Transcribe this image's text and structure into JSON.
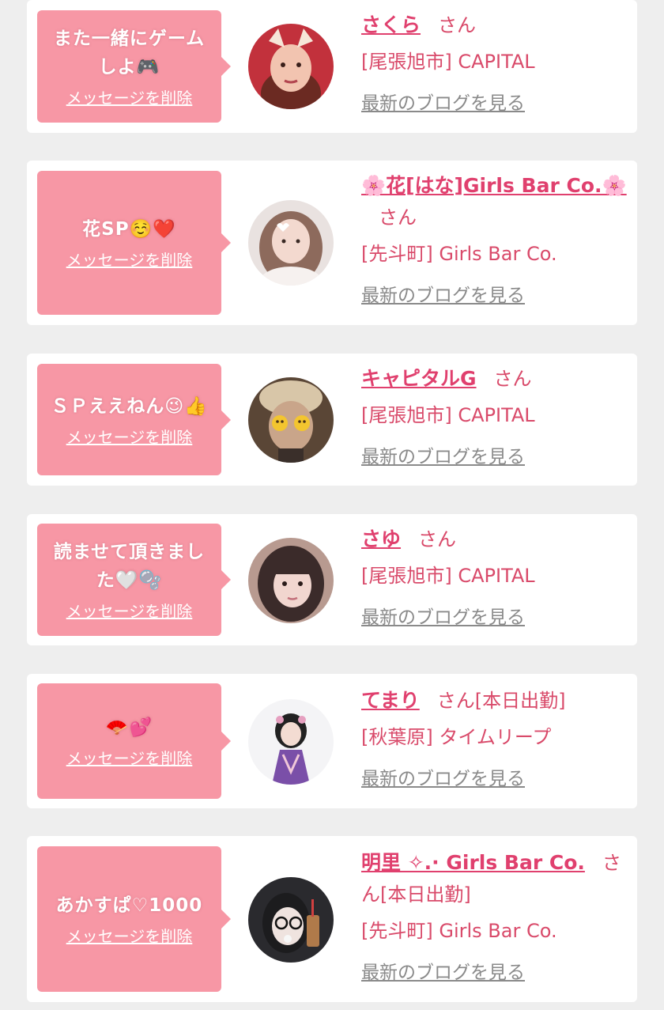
{
  "theme": {
    "page_bg": "#eeeeee",
    "card_bg": "#ffffff",
    "bubble_bg": "#f797a5",
    "name_color": "#e0406e",
    "text_color": "#d94a6a",
    "link_gray": "#8a8a8a"
  },
  "items": [
    {
      "message": "また一緒にゲームしよ🎮",
      "delete_label": "メッセージを削除",
      "name": "さくら",
      "honorific": "さん",
      "status": "",
      "shop": "[尾張旭市] CAPITAL",
      "blog_label": "最新のブログを見る",
      "avatar_colors": [
        "#c2313c",
        "#f2c4b0",
        "#6b2a22"
      ]
    },
    {
      "message": "花SP☺️❤️",
      "delete_label": "メッセージを削除",
      "name": "🌸花[はな]Girls Bar Co.🌸",
      "honorific": "さん",
      "status": "",
      "shop": "[先斗町] Girls Bar Co.",
      "blog_label": "最新のブログを見る",
      "avatar_colors": [
        "#e9e2e0",
        "#f3d9cf",
        "#8d6a5c"
      ]
    },
    {
      "message": "ＳＰええねん😉👍",
      "delete_label": "メッセージを削除",
      "name": "キャピタルG",
      "honorific": "さん",
      "status": "",
      "shop": "[尾張旭市] CAPITAL",
      "blog_label": "最新のブログを見る",
      "avatar_colors": [
        "#5a4636",
        "#c9a58a",
        "#f3c52f"
      ]
    },
    {
      "message": "読ませて頂きました🤍🫧",
      "delete_label": "メッセージを削除",
      "name": "さゆ",
      "honorific": "さん",
      "status": "",
      "shop": "[尾張旭市] CAPITAL",
      "blog_label": "最新のブログを見る",
      "avatar_colors": [
        "#b89a90",
        "#f1d6cf",
        "#3b2b2a"
      ]
    },
    {
      "message": "🪭💕",
      "delete_label": "メッセージを削除",
      "name": "てまり",
      "honorific": "さん",
      "status": "[本日出勤]",
      "shop": "[秋葉原] タイムリープ",
      "blog_label": "最新のブログを見る",
      "avatar_colors": [
        "#f4f4f6",
        "#7a4fa8",
        "#222222"
      ]
    },
    {
      "message": "あかすぱ♡1000",
      "delete_label": "メッセージを削除",
      "name": "明里 ✧.· Girls Bar Co.",
      "honorific": "さん",
      "status": "[本日出勤]",
      "shop": "[先斗町] Girls Bar Co.",
      "blog_label": "最新のブログを見る",
      "avatar_colors": [
        "#2a2a2e",
        "#efe3df",
        "#b07a4a"
      ]
    }
  ]
}
